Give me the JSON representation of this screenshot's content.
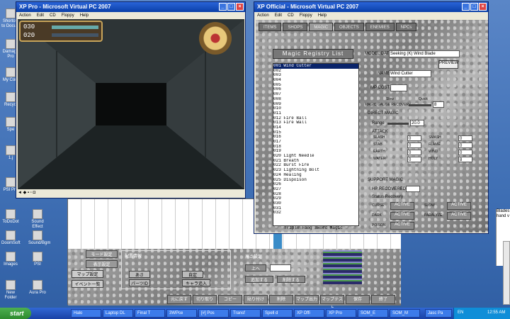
{
  "desktop_icons": [
    {
      "label": "Shortcut to Docum"
    },
    {
      "label": "Damage Pro"
    },
    {
      "label": "My Com"
    },
    {
      "label": "Recycl"
    },
    {
      "label": "Spe"
    },
    {
      "label": "1.j"
    },
    {
      "label": "PSI Pro"
    },
    {
      "label": "ToDoDot"
    },
    {
      "label": "Sound Effect"
    },
    {
      "label": "Sound/Bgm"
    },
    {
      "label": "DoomSoft"
    },
    {
      "label": "Images"
    },
    {
      "label": "PSI"
    },
    {
      "label": "New Folder"
    },
    {
      "label": "Aura Pro"
    }
  ],
  "win_left": {
    "title": "XP Pro - Microsoft Virtual PC 2007",
    "menu": [
      "Action",
      "Edit",
      "CD",
      "Floppy",
      "Help"
    ],
    "hud_top": "030",
    "hud_bottom": "020"
  },
  "win_right": {
    "title": "XP Official - Microsoft Virtual PC 2007",
    "menu": [
      "Action",
      "Edit",
      "CD",
      "Floppy",
      "Help"
    ],
    "tabs": [
      "ITEMS",
      "SHOPS",
      "MAGIC",
      "OBJECTS",
      "ENEMIES",
      "NPCs"
    ],
    "list_title": "Magic Registry List",
    "list": [
      "001 Wind Cutter",
      "002",
      "003",
      "004",
      "005",
      "006",
      "007",
      "008",
      "009",
      "010",
      "011",
      "012 Fire Ball",
      "013 Fire Wall",
      "014",
      "015",
      "016",
      "017",
      "018",
      "019",
      "020 Light Needle",
      "021 Breath",
      "022 Burst Fire",
      "023 Lightning Bolt",
      "024 Healing",
      "025 Dispoison",
      "026",
      "027",
      "028",
      "029",
      "030",
      "031",
      "032"
    ],
    "list_footer": "Triple Fang Sword Magic",
    "model_label": "MODEL DATA",
    "model_value": "Seeking (K) Wind Blade",
    "preview": "PREVIEW",
    "name_label": "NAME",
    "name_value": "Wind Cutter",
    "mp_label": "MP COST",
    "gauge_label": "MAGIC GAUGE RECOVERY",
    "slow": "Slow",
    "quick": "Quick",
    "gauge_value": "8",
    "direct": "DIRECT MAGIC",
    "range_label": "Range",
    "range_value": "20.0",
    "attack": "ATTACK",
    "attacks_left": [
      {
        "name": "SLASH",
        "v": "0"
      },
      {
        "name": "STAB",
        "v": "0"
      },
      {
        "name": "EARTH",
        "v": "0"
      },
      {
        "name": "WATER",
        "v": "0"
      }
    ],
    "attacks_right": [
      {
        "name": "SMASH",
        "v": "0"
      },
      {
        "name": "FLAME",
        "v": "0"
      },
      {
        "name": "WIND",
        "v": "0"
      },
      {
        "name": "HOLY",
        "v": "8"
      }
    ],
    "support": "SUPPORT MAGIC",
    "hp_label": "HP RECOVERED",
    "status": "Status Recovery",
    "status_left": [
      {
        "name": "CURSE",
        "b": "ACTIVE"
      },
      {
        "name": "DARK",
        "b": "ACTIVE"
      },
      {
        "name": "POISON",
        "b": "ACTIVE"
      }
    ],
    "status_right": [
      {
        "name": "SLOW",
        "b": "ACTIVE"
      },
      {
        "name": "PARALYZE",
        "b": "ACTIVE"
      }
    ]
  },
  "win_back": {
    "btns_left": [
      "モード設定",
      "表示設定",
      "マップ設定",
      "イベント一覧"
    ],
    "group_title": "配置情報",
    "fields": [
      "あさ",
      "パーツID",
      "自定",
      "キャラ追入"
    ],
    "right_title": "高さ設定",
    "up": "上へ",
    "add": "追加する",
    "del": "削除する"
  },
  "bottom_bar": [
    "元に戻す",
    "切り取り",
    "コピー",
    "貼り付け",
    "削除",
    "マップ出力",
    "マップテスト",
    "保存",
    "終了"
  ],
  "side_text": [
    "Blades",
    "hand v"
  ],
  "taskbar": {
    "start": "start",
    "items": [
      "Halo",
      "Laptop DL",
      "Final T",
      "3WPce",
      "[#] Pos",
      "Transf",
      "Spell d",
      "XP Offi",
      "XP Pro",
      "SOM_E",
      "SOM_M"
    ],
    "tray_item": "Jasc Pa",
    "lang": "EN",
    "time": "12:55 AM"
  }
}
